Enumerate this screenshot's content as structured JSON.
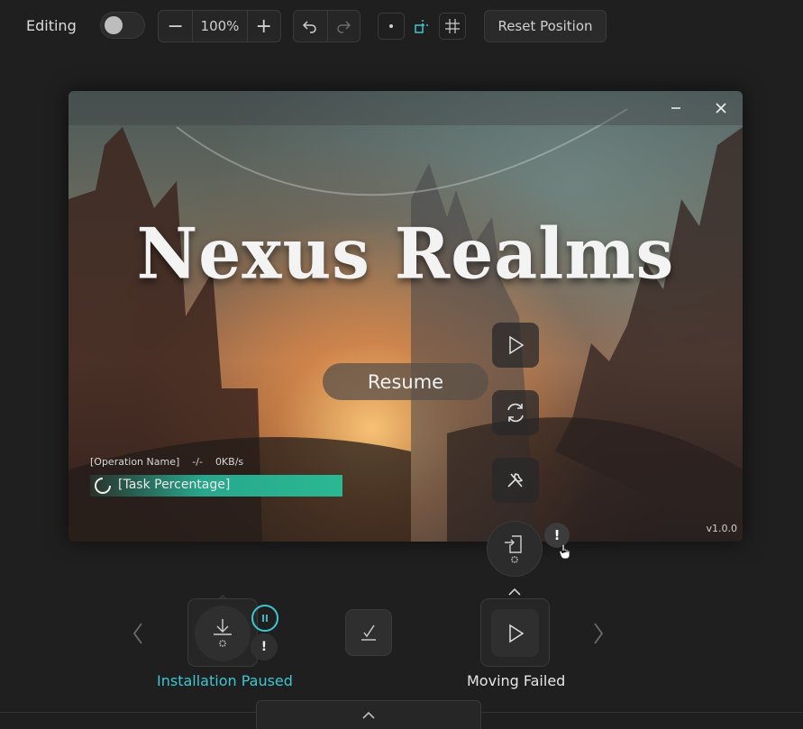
{
  "toolbar": {
    "editing_label": "Editing",
    "zoom_minus": "−",
    "zoom_value": "100%",
    "zoom_plus": "+",
    "reset_label": "Reset Position"
  },
  "window": {
    "game_title": "Nexus Realms",
    "resume_label": "Resume",
    "operation_name": "[Operation Name]",
    "operation_eta": "-/-",
    "operation_speed": "0KB/s",
    "task_percentage": "[Task Percentage]",
    "version": "v1.0.0"
  },
  "bottom": {
    "install_status": "Installation Paused",
    "move_status": "Moving Failed",
    "alert_mark": "!"
  },
  "colors": {
    "accent_teal": "#3fc6d3",
    "progress_green": "#28a88e",
    "background": "#1f1f1f"
  }
}
